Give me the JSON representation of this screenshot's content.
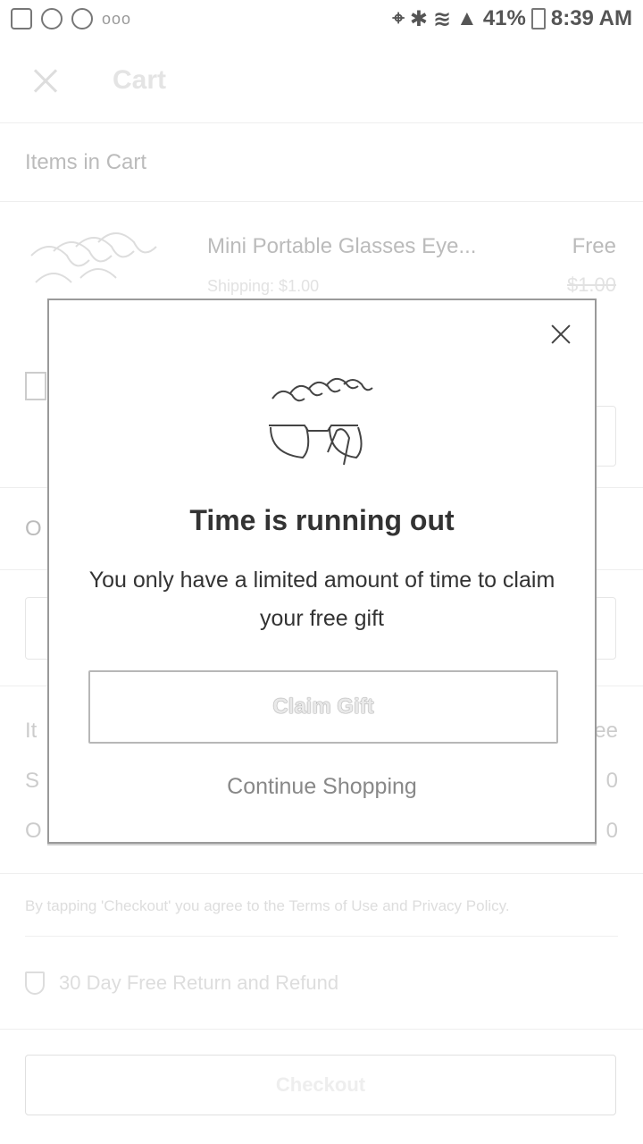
{
  "status_bar": {
    "dots": "ooo",
    "battery": "41%",
    "time": "8:39 AM"
  },
  "header": {
    "title": "Cart"
  },
  "cart": {
    "section_title": "Items in Cart",
    "item": {
      "name": "Mini Portable Glasses Eye...",
      "shipping": "Shipping: $1.00",
      "price": "Free",
      "old_price": "$1.00"
    }
  },
  "summary": {
    "order_label_partial": "O",
    "items_label_partial": "It",
    "items_value_partial": "ee",
    "shipping_label_partial": "S",
    "shipping_value_partial": "0",
    "total_label_partial": "O",
    "total_value_partial": "0"
  },
  "footer": {
    "terms": "By tapping 'Checkout' you agree to the Terms of Use and Privacy Policy.",
    "refund": "30 Day Free Return and Refund",
    "checkout_label": "Checkout"
  },
  "modal": {
    "title": "Time is running out",
    "body": "You only have a limited amount of time to claim your free gift",
    "claim_label": "Claim Gift",
    "continue_label": "Continue Shopping"
  }
}
